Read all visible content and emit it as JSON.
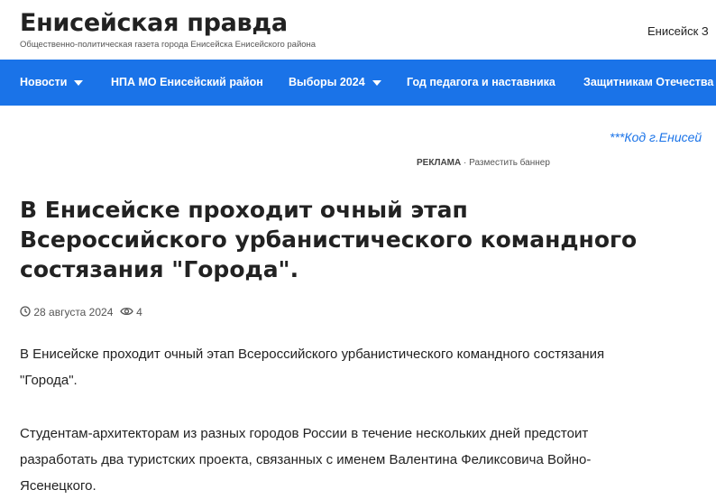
{
  "header": {
    "site_title": "Енисейская правда",
    "site_description": "Общественно-политическая газета города Енисейска Енисейского района",
    "right_text": "Енисейск  З"
  },
  "nav": {
    "items": [
      {
        "label": "Новости",
        "has_dropdown": true
      },
      {
        "label": "НПА МО Енисейский район",
        "has_dropdown": false
      },
      {
        "label": "Выборы 2024",
        "has_dropdown": true
      },
      {
        "label": "Год педагога и наставника",
        "has_dropdown": false
      },
      {
        "label": "Защитникам Отечества",
        "has_dropdown": false
      }
    ],
    "color": "#1a73e8"
  },
  "marquee": {
    "text": "***Код г.Енисей"
  },
  "ad": {
    "label": "РЕКЛАМА",
    "separator": "·",
    "link": "Разместить баннер"
  },
  "article": {
    "title": "В Енисейске проходит очный этап Всероссийского урбанистического командного состязания \"Города\".",
    "date": "28 августа 2024",
    "views": "4",
    "paragraphs": [
      "В Енисейске проходит очный этап Всероссийского урбанистического командного состязания \"Города\".",
      "Студентам-архитекторам из разных городов России в течение нескольких дней предстоит разработать два туристских проекта, связанных с именем Валентина Феликсовича Войно-Ясенецкого."
    ]
  }
}
